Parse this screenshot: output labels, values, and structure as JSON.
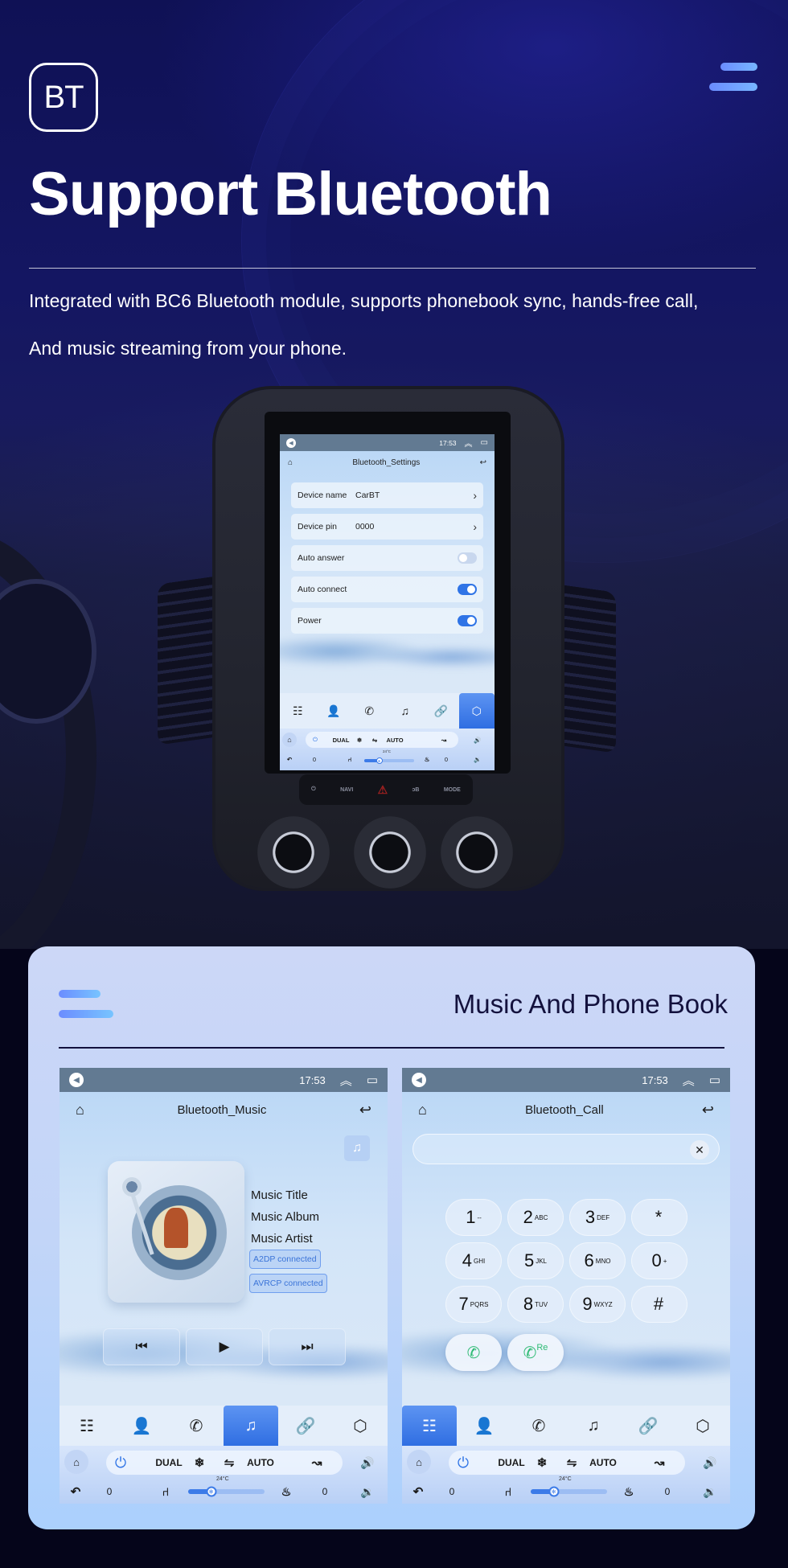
{
  "hero": {
    "badge": "BT",
    "title": "Support Bluetooth",
    "description_line1": "Integrated with BC6 Bluetooth module, supports phonebook sync, hands-free call,",
    "description_line2": "And music streaming from your phone."
  },
  "head_unit_buttons": [
    "⏻",
    "NAVI",
    "⚠",
    "ↄB",
    "MODE"
  ],
  "settings_screen": {
    "status_bar": {
      "time": "17:53"
    },
    "title": "Bluetooth_Settings",
    "rows": [
      {
        "label": "Device name",
        "value": "CarBT",
        "type": "link"
      },
      {
        "label": "Device pin",
        "value": "0000",
        "type": "link"
      },
      {
        "label": "Auto answer",
        "type": "toggle",
        "on": false
      },
      {
        "label": "Auto connect",
        "type": "toggle",
        "on": true
      },
      {
        "label": "Power",
        "type": "toggle",
        "on": true
      }
    ],
    "active_nav": "settings"
  },
  "nav_items": [
    {
      "name": "apps",
      "icon": "☷"
    },
    {
      "name": "contacts",
      "icon": "👤"
    },
    {
      "name": "phone",
      "icon": "✆"
    },
    {
      "name": "music",
      "icon": "♫"
    },
    {
      "name": "link",
      "icon": "🔗"
    },
    {
      "name": "settings",
      "icon": "⬡"
    }
  ],
  "climate": {
    "dual": "DUAL",
    "auto": "AUTO",
    "temperature": "24°C",
    "left_seat_level": "0",
    "right_seat_level": "0",
    "fan_level_fraction": 0.3
  },
  "section": {
    "title": "Music And Phone Book"
  },
  "music_screen": {
    "status_bar": {
      "time": "17:53"
    },
    "title": "Bluetooth_Music",
    "track_title": "Music Title",
    "album": "Music Album",
    "artist": "Music Artist",
    "badges": [
      "A2DP  connected",
      "AVRCP connected"
    ],
    "active_nav": "music"
  },
  "call_screen": {
    "status_bar": {
      "time": "17:53"
    },
    "title": "Bluetooth_Call",
    "number_input": "",
    "keys": [
      {
        "digit": "1",
        "letters": "--"
      },
      {
        "digit": "2",
        "letters": "ABC"
      },
      {
        "digit": "3",
        "letters": "DEF"
      },
      {
        "digit": "*",
        "letters": ""
      },
      {
        "digit": "4",
        "letters": "GHI"
      },
      {
        "digit": "5",
        "letters": "JKL"
      },
      {
        "digit": "6",
        "letters": "MNO"
      },
      {
        "digit": "0",
        "letters": "+"
      },
      {
        "digit": "7",
        "letters": "PQRS"
      },
      {
        "digit": "8",
        "letters": "TUV"
      },
      {
        "digit": "9",
        "letters": "WXYZ"
      },
      {
        "digit": "#",
        "letters": ""
      }
    ],
    "redial_label": "Re",
    "active_nav": "apps"
  }
}
